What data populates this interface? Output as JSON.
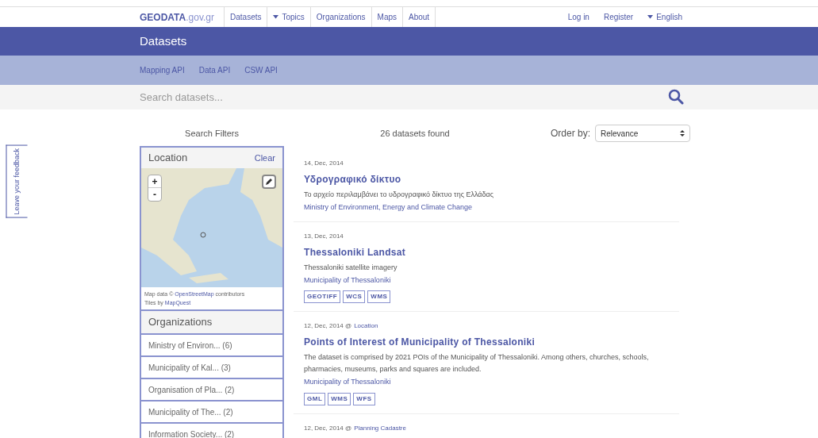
{
  "nav": {
    "logo_main": "GEODATA",
    "logo_domain": ".gov.gr",
    "links": [
      {
        "label": "Datasets",
        "dropdown": false
      },
      {
        "label": "Topics",
        "dropdown": true
      },
      {
        "label": "Organizations",
        "dropdown": false
      },
      {
        "label": "Maps",
        "dropdown": false
      },
      {
        "label": "About",
        "dropdown": false
      }
    ],
    "right_links": [
      {
        "label": "Log in",
        "dropdown": false
      },
      {
        "label": "Register",
        "dropdown": false
      },
      {
        "label": "English",
        "dropdown": true
      }
    ]
  },
  "page_title": "Datasets",
  "sub_links": [
    "Mapping API",
    "Data API",
    "CSW API"
  ],
  "search": {
    "placeholder": "Search datasets..."
  },
  "feedback_tab": "Leave your feedback",
  "filters_heading": "Search Filters",
  "results_count": "26 datasets found",
  "order": {
    "label": "Order by:",
    "value": "Relevance"
  },
  "location": {
    "title": "Location",
    "clear": "Clear",
    "zoom_in": "+",
    "zoom_out": "-",
    "attribution_prefix": "Map data ©",
    "attribution_link": "OpenStreetMap",
    "attribution_suffix": "contributors",
    "tiles_prefix": "Tiles by",
    "tiles_link": "MapQuest"
  },
  "organizations": {
    "title": "Organizations",
    "items": [
      "Ministry of Environ... (6)",
      "Municipality of Kal... (3)",
      "Organisation of Pla... (2)",
      "Municipality of The... (2)",
      "Information Society... (2)"
    ]
  },
  "datasets": [
    {
      "date": "14, Dec, 2014",
      "title": "Υδρογραφικό δίκτυο",
      "description": "Το αρχείο περιλαμβάνει το υδρογραφικό δίκτυο της Ελλάδας",
      "organization": "Ministry of Environment, Energy and Climate Change"
    },
    {
      "date": "13, Dec, 2014",
      "title": "Thessaloniki Landsat",
      "description": "Thessaloniki satellite imagery",
      "organization": "Municipality of Thessaloniki",
      "formats": [
        "GEOTIFF",
        "WCS",
        "WMS"
      ]
    },
    {
      "date": "12, Dec, 2014 @",
      "topic": "Location",
      "title": "Points of Interest of Municipality of Thessaloniki",
      "description": "The dataset is comprised by 2021 POIs of the Municipality of Thessaloniki. Among others, churches, schools, pharmacies, museums, parks and squares are included.",
      "organization": "Municipality of Thessaloniki",
      "formats": [
        "GML",
        "WMS",
        "WFS"
      ]
    },
    {
      "date": "12, Dec, 2014 @",
      "topic": "Planning Cadastre"
    }
  ]
}
